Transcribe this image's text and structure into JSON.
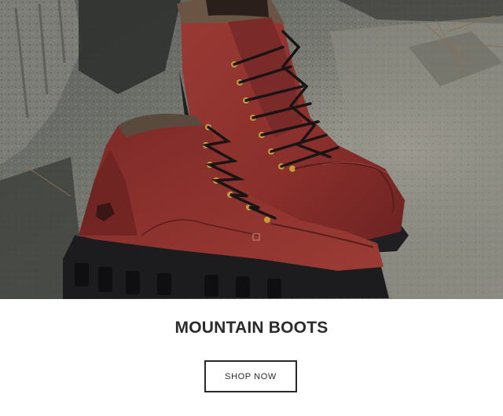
{
  "hero": {
    "product": "red leather hiking boots on rocks"
  },
  "promo": {
    "title": "MOUNTAIN BOOTS",
    "cta_label": "SHOP NOW"
  },
  "colors": {
    "title": "#2a2a2a",
    "boot_leather": "#8a2f2c",
    "sole": "#1f1f22"
  }
}
